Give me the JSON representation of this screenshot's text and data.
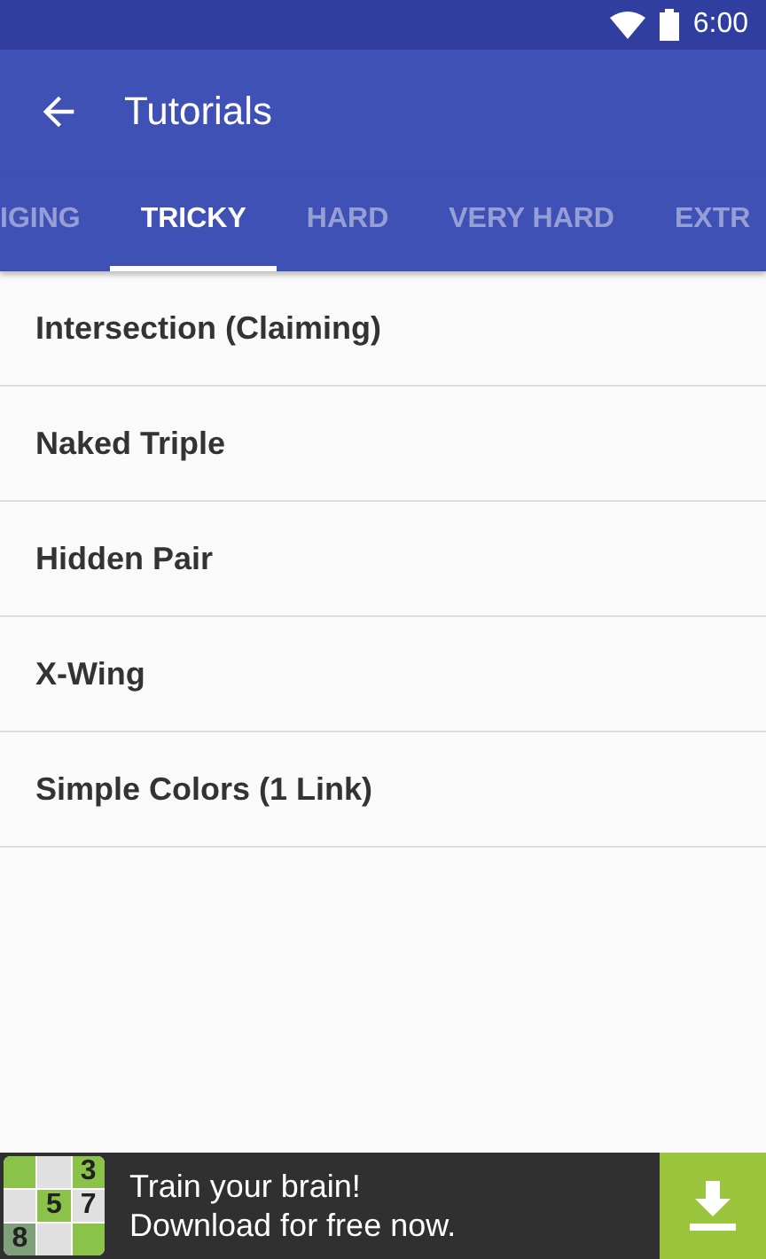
{
  "status_bar": {
    "time": "6:00"
  },
  "toolbar": {
    "title": "Tutorials"
  },
  "tabs": [
    {
      "label": "IGING",
      "selected": false
    },
    {
      "label": "TRICKY",
      "selected": true
    },
    {
      "label": "HARD",
      "selected": false
    },
    {
      "label": "VERY HARD",
      "selected": false
    },
    {
      "label": "EXTR",
      "selected": false
    }
  ],
  "items": [
    "Intersection (Claiming)",
    "Naked Triple",
    "Hidden Pair",
    "X-Wing",
    "Simple Colors (1 Link)"
  ],
  "ad": {
    "lines": [
      "Train your brain!",
      "Download for free now."
    ],
    "grid": [
      {
        "color": "#8bc34a"
      },
      {
        "color": "#e0e0e0"
      },
      {
        "text": "3",
        "color": "#8bc34a"
      },
      {
        "color": "#e0e0e0"
      },
      {
        "text": "5",
        "color": "#8bc34a"
      },
      {
        "text": "7",
        "color": "#e0e0e0"
      },
      {
        "text": "8",
        "color": "#7fa07a"
      },
      {
        "color": "#e0e0e0"
      },
      {
        "color": "#8bc34a"
      }
    ]
  }
}
